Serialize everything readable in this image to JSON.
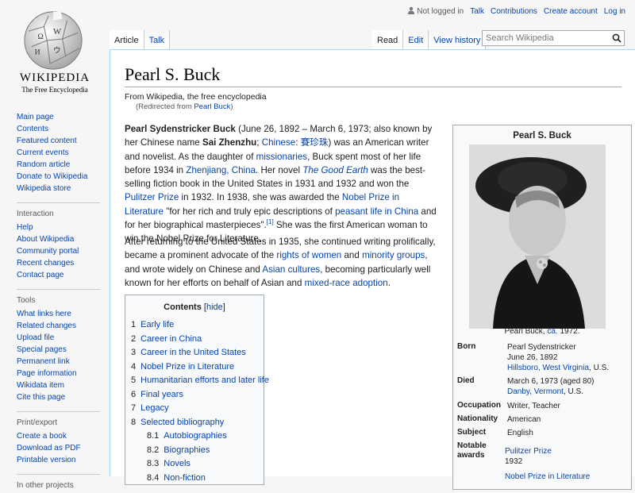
{
  "personal": {
    "not_logged_in": "Not logged in",
    "talk": "Talk",
    "contributions": "Contributions",
    "create_account": "Create account",
    "log_in": "Log in"
  },
  "logo": {
    "wordmark": "Wikipedia",
    "tagline": "The Free Encyclopedia"
  },
  "tabs": {
    "article": "Article",
    "talk": "Talk",
    "read": "Read",
    "edit": "Edit",
    "view_history": "View history"
  },
  "search": {
    "placeholder": "Search Wikipedia"
  },
  "sidebar": {
    "main": [
      "Main page",
      "Contents",
      "Featured content",
      "Current events",
      "Random article",
      "Donate to Wikipedia",
      "Wikipedia store"
    ],
    "interaction_heading": "Interaction",
    "interaction": [
      "Help",
      "About Wikipedia",
      "Community portal",
      "Recent changes",
      "Contact page"
    ],
    "tools_heading": "Tools",
    "tools": [
      "What links here",
      "Related changes",
      "Upload file",
      "Special pages",
      "Permanent link",
      "Page information",
      "Wikidata item",
      "Cite this page"
    ],
    "print_heading": "Print/export",
    "print": [
      "Create a book",
      "Download as PDF",
      "Printable version"
    ],
    "other_heading": "In other projects"
  },
  "article": {
    "title": "Pearl S. Buck",
    "tagline": "From Wikipedia, the free encyclopedia",
    "redirect_prefix": "(Redirected from ",
    "redirect_link": "Pearl Buck",
    "redirect_suffix": ")",
    "p1": {
      "name": "Pearl Sydenstricker Buck",
      "t1": " (June 26, 1892 – March 6, 1973; also known by her Chinese name ",
      "name2": "Sai Zhenzhu",
      "t2": "; ",
      "chinese": "Chinese",
      "t3": ": ",
      "hanzi": "賽珍珠",
      "t4": ") was an American writer and novelist. As the daughter of ",
      "missionaries": "missionaries",
      "t5": ", Buck spent most of her life before 1934 in ",
      "zhenjiang": "Zhenjiang, China",
      "t6": ". Her novel ",
      "good_earth": "The Good Earth",
      "t7": " was the best-selling fiction book in the United States in 1931 and 1932 and won the ",
      "pulitzer": "Pulitzer Prize",
      "t8": " in 1932. In 1938, she was awarded the ",
      "nobel": "Nobel Prize in Literature",
      "t9": " \"for her rich and truly epic descriptions of ",
      "peasant": "peasant life in China",
      "t10": " and for her biographical masterpieces\".",
      "ref": "[1]",
      "t11": " She was the first American woman to win the Nobel Prize for Literature."
    },
    "p2": {
      "t1": "After returning to the United States in 1935, she continued writing prolifically, became a prominent advocate of the ",
      "rights": "rights of women",
      "t2": " and ",
      "minority": "minority groups",
      "t3": ", and wrote widely on Chinese and ",
      "asian": "Asian cultures",
      "t4": ", becoming particularly well known for her efforts on behalf of Asian and ",
      "mixed": "mixed-race adoption",
      "t5": "."
    }
  },
  "toc": {
    "heading": "Contents",
    "hide": "hide",
    "items": [
      {
        "num": "1",
        "label": "Early life"
      },
      {
        "num": "2",
        "label": "Career in China"
      },
      {
        "num": "3",
        "label": "Career in the United States"
      },
      {
        "num": "4",
        "label": "Nobel Prize in Literature"
      },
      {
        "num": "5",
        "label": "Humanitarian efforts and later life"
      },
      {
        "num": "6",
        "label": "Final years"
      },
      {
        "num": "7",
        "label": "Legacy"
      },
      {
        "num": "8",
        "label": "Selected bibliography"
      },
      {
        "num": "8.1",
        "label": "Autobiographies"
      },
      {
        "num": "8.2",
        "label": "Biographies"
      },
      {
        "num": "8.3",
        "label": "Novels"
      },
      {
        "num": "8.4",
        "label": "Non-fiction"
      }
    ]
  },
  "infobox": {
    "title": "Pearl S. Buck",
    "caption_prefix": "Pearl Buck, ",
    "caption_ca": "ca.",
    "caption_suffix": " 1972.",
    "born_label": "Born",
    "born_name": "Pearl Sydenstricker",
    "born_date": "June 26, 1892",
    "born_place": "Hillsboro, West Virginia",
    "born_country": ", U.S.",
    "died_label": "Died",
    "died_date": "March 6, 1973 (aged 80)",
    "died_place": "Danby, Vermont",
    "died_country": ", U.S.",
    "occupation_label": "Occupation",
    "occupation": "Writer, Teacher",
    "nationality_label": "Nationality",
    "nationality": "American",
    "subject_label": "Subject",
    "subject": "English",
    "awards_label": "Notable awards",
    "award1": "Pulitzer Prize",
    "award1_year": "1932",
    "award2": "Nobel Prize in Literature"
  }
}
